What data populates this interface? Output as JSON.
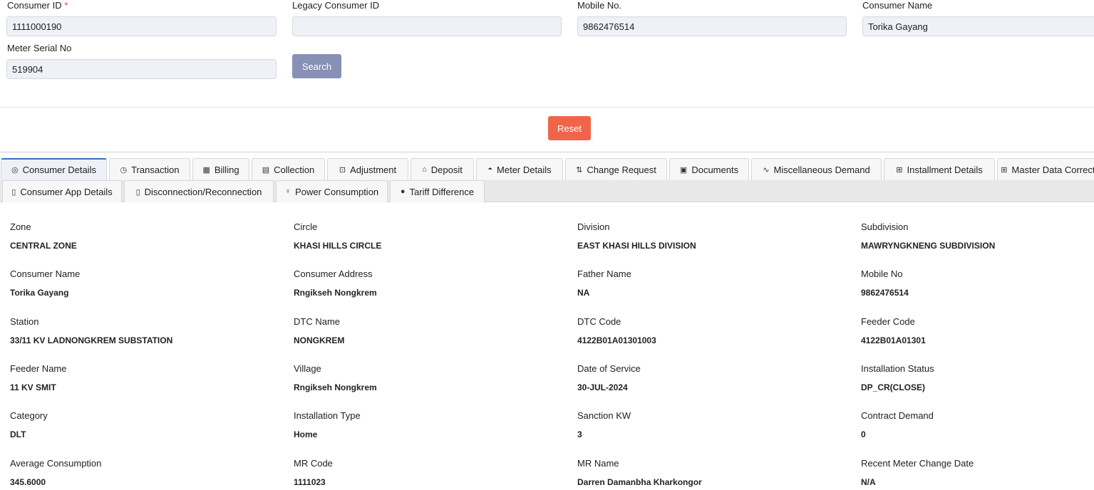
{
  "search": {
    "consumer_id": {
      "label": "Consumer ID",
      "required": "*",
      "value": "1111000190"
    },
    "legacy_id": {
      "label": "Legacy Consumer ID",
      "value": ""
    },
    "mobile": {
      "label": "Mobile No.",
      "value": "9862476514"
    },
    "consumer_name": {
      "label": "Consumer Name",
      "value": "Torika Gayang"
    },
    "meter_serial": {
      "label": "Meter Serial No",
      "value": "519904"
    },
    "search_label": "Search",
    "reset_label": "Reset"
  },
  "tabs_row1": [
    {
      "label": "Consumer Details",
      "icon": "◎"
    },
    {
      "label": "Transaction",
      "icon": "◷"
    },
    {
      "label": "Billing",
      "icon": "▦"
    },
    {
      "label": "Collection",
      "icon": "▤"
    },
    {
      "label": "Adjustment",
      "icon": "⊡"
    },
    {
      "label": "Deposit",
      "icon": "⌂"
    },
    {
      "label": "Meter Details",
      "icon": "◓"
    },
    {
      "label": "Change Request",
      "icon": "⇅"
    },
    {
      "label": "Documents",
      "icon": "▣"
    },
    {
      "label": "Miscellaneous Demand",
      "icon": "∿"
    },
    {
      "label": "Installment Details",
      "icon": "⊞"
    },
    {
      "label": "Master Data Correction",
      "icon": "⊞"
    }
  ],
  "tabs_row2": [
    {
      "label": "Consumer App Details",
      "icon": "▯"
    },
    {
      "label": "Disconnection/Reconnection",
      "icon": "▯"
    },
    {
      "label": "Power Consumption",
      "icon": "♀"
    },
    {
      "label": "Tariff Difference",
      "icon": "●"
    }
  ],
  "details": [
    [
      "Zone",
      "CENTRAL ZONE"
    ],
    [
      "Circle",
      "KHASI HILLS CIRCLE"
    ],
    [
      "Division",
      "EAST KHASI HILLS DIVISION"
    ],
    [
      "Subdivision",
      "MAWRYNGKNENG SUBDIVISION"
    ],
    [
      "Consumer Name",
      "Torika Gayang"
    ],
    [
      "Consumer Address",
      "Rngikseh Nongkrem"
    ],
    [
      "Father Name",
      "NA"
    ],
    [
      "Mobile No",
      "9862476514"
    ],
    [
      "Station",
      "33/11 KV LADNONGKREM SUBSTATION"
    ],
    [
      "DTC Name",
      "NONGKREM"
    ],
    [
      "DTC Code",
      "4122B01A01301003"
    ],
    [
      "Feeder Code",
      "4122B01A01301"
    ],
    [
      "Feeder Name",
      "11 KV SMIT"
    ],
    [
      "Village",
      "Rngikseh Nongkrem"
    ],
    [
      "Date of Service",
      "30-JUL-2024"
    ],
    [
      "Installation Status",
      "DP_CR(CLOSE)"
    ],
    [
      "Category",
      "DLT"
    ],
    [
      "Installation Type",
      "Home"
    ],
    [
      "Sanction KW",
      "3"
    ],
    [
      "Contract Demand",
      "0"
    ],
    [
      "Average Consumption",
      "345.6000"
    ],
    [
      "MR Code",
      "1111023"
    ],
    [
      "MR Name",
      "Darren Damanbha Kharkongor"
    ],
    [
      "Recent Meter Change Date",
      "N/A"
    ]
  ]
}
